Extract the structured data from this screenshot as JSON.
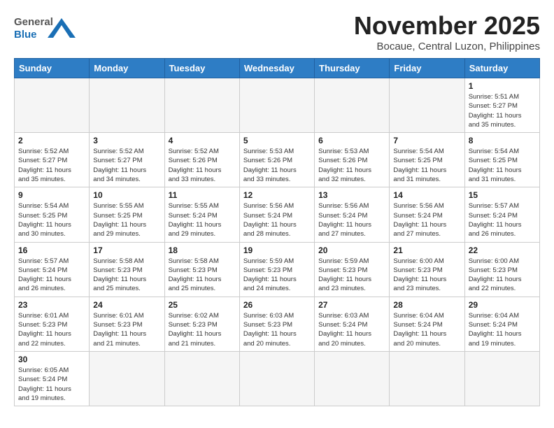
{
  "header": {
    "logo_line1": "General",
    "logo_line2": "Blue",
    "month_title": "November 2025",
    "location": "Bocaue, Central Luzon, Philippines"
  },
  "weekdays": [
    "Sunday",
    "Monday",
    "Tuesday",
    "Wednesday",
    "Thursday",
    "Friday",
    "Saturday"
  ],
  "weeks": [
    [
      {
        "day": "",
        "info": ""
      },
      {
        "day": "",
        "info": ""
      },
      {
        "day": "",
        "info": ""
      },
      {
        "day": "",
        "info": ""
      },
      {
        "day": "",
        "info": ""
      },
      {
        "day": "",
        "info": ""
      },
      {
        "day": "1",
        "info": "Sunrise: 5:51 AM\nSunset: 5:27 PM\nDaylight: 11 hours\nand 35 minutes."
      }
    ],
    [
      {
        "day": "2",
        "info": "Sunrise: 5:52 AM\nSunset: 5:27 PM\nDaylight: 11 hours\nand 35 minutes."
      },
      {
        "day": "3",
        "info": "Sunrise: 5:52 AM\nSunset: 5:27 PM\nDaylight: 11 hours\nand 34 minutes."
      },
      {
        "day": "4",
        "info": "Sunrise: 5:52 AM\nSunset: 5:26 PM\nDaylight: 11 hours\nand 33 minutes."
      },
      {
        "day": "5",
        "info": "Sunrise: 5:53 AM\nSunset: 5:26 PM\nDaylight: 11 hours\nand 33 minutes."
      },
      {
        "day": "6",
        "info": "Sunrise: 5:53 AM\nSunset: 5:26 PM\nDaylight: 11 hours\nand 32 minutes."
      },
      {
        "day": "7",
        "info": "Sunrise: 5:54 AM\nSunset: 5:25 PM\nDaylight: 11 hours\nand 31 minutes."
      },
      {
        "day": "8",
        "info": "Sunrise: 5:54 AM\nSunset: 5:25 PM\nDaylight: 11 hours\nand 31 minutes."
      }
    ],
    [
      {
        "day": "9",
        "info": "Sunrise: 5:54 AM\nSunset: 5:25 PM\nDaylight: 11 hours\nand 30 minutes."
      },
      {
        "day": "10",
        "info": "Sunrise: 5:55 AM\nSunset: 5:25 PM\nDaylight: 11 hours\nand 29 minutes."
      },
      {
        "day": "11",
        "info": "Sunrise: 5:55 AM\nSunset: 5:24 PM\nDaylight: 11 hours\nand 29 minutes."
      },
      {
        "day": "12",
        "info": "Sunrise: 5:56 AM\nSunset: 5:24 PM\nDaylight: 11 hours\nand 28 minutes."
      },
      {
        "day": "13",
        "info": "Sunrise: 5:56 AM\nSunset: 5:24 PM\nDaylight: 11 hours\nand 27 minutes."
      },
      {
        "day": "14",
        "info": "Sunrise: 5:56 AM\nSunset: 5:24 PM\nDaylight: 11 hours\nand 27 minutes."
      },
      {
        "day": "15",
        "info": "Sunrise: 5:57 AM\nSunset: 5:24 PM\nDaylight: 11 hours\nand 26 minutes."
      }
    ],
    [
      {
        "day": "16",
        "info": "Sunrise: 5:57 AM\nSunset: 5:24 PM\nDaylight: 11 hours\nand 26 minutes."
      },
      {
        "day": "17",
        "info": "Sunrise: 5:58 AM\nSunset: 5:23 PM\nDaylight: 11 hours\nand 25 minutes."
      },
      {
        "day": "18",
        "info": "Sunrise: 5:58 AM\nSunset: 5:23 PM\nDaylight: 11 hours\nand 25 minutes."
      },
      {
        "day": "19",
        "info": "Sunrise: 5:59 AM\nSunset: 5:23 PM\nDaylight: 11 hours\nand 24 minutes."
      },
      {
        "day": "20",
        "info": "Sunrise: 5:59 AM\nSunset: 5:23 PM\nDaylight: 11 hours\nand 23 minutes."
      },
      {
        "day": "21",
        "info": "Sunrise: 6:00 AM\nSunset: 5:23 PM\nDaylight: 11 hours\nand 23 minutes."
      },
      {
        "day": "22",
        "info": "Sunrise: 6:00 AM\nSunset: 5:23 PM\nDaylight: 11 hours\nand 22 minutes."
      }
    ],
    [
      {
        "day": "23",
        "info": "Sunrise: 6:01 AM\nSunset: 5:23 PM\nDaylight: 11 hours\nand 22 minutes."
      },
      {
        "day": "24",
        "info": "Sunrise: 6:01 AM\nSunset: 5:23 PM\nDaylight: 11 hours\nand 21 minutes."
      },
      {
        "day": "25",
        "info": "Sunrise: 6:02 AM\nSunset: 5:23 PM\nDaylight: 11 hours\nand 21 minutes."
      },
      {
        "day": "26",
        "info": "Sunrise: 6:03 AM\nSunset: 5:23 PM\nDaylight: 11 hours\nand 20 minutes."
      },
      {
        "day": "27",
        "info": "Sunrise: 6:03 AM\nSunset: 5:24 PM\nDaylight: 11 hours\nand 20 minutes."
      },
      {
        "day": "28",
        "info": "Sunrise: 6:04 AM\nSunset: 5:24 PM\nDaylight: 11 hours\nand 20 minutes."
      },
      {
        "day": "29",
        "info": "Sunrise: 6:04 AM\nSunset: 5:24 PM\nDaylight: 11 hours\nand 19 minutes."
      }
    ],
    [
      {
        "day": "30",
        "info": "Sunrise: 6:05 AM\nSunset: 5:24 PM\nDaylight: 11 hours\nand 19 minutes."
      },
      {
        "day": "",
        "info": ""
      },
      {
        "day": "",
        "info": ""
      },
      {
        "day": "",
        "info": ""
      },
      {
        "day": "",
        "info": ""
      },
      {
        "day": "",
        "info": ""
      },
      {
        "day": "",
        "info": ""
      }
    ]
  ]
}
